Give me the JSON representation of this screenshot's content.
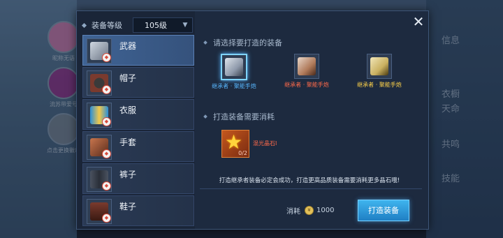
{
  "background": {
    "side_items": [
      {
        "label": "昵称无语",
        "color": "#e07ab0"
      },
      {
        "label": "流苏带爱号",
        "color": "#9c2b8c"
      },
      {
        "label": "点击更换徽章",
        "color": "#7f8a98"
      }
    ],
    "right_tabs": [
      "信息",
      "衣橱",
      "天命",
      "共鸣",
      "技能"
    ]
  },
  "modal": {
    "level": {
      "label": "装备等级",
      "value": "105级"
    },
    "categories": [
      {
        "label": "武器",
        "color": "#9aa6b6"
      },
      {
        "label": "帽子",
        "color": "#7a3a2e"
      },
      {
        "label": "衣服",
        "color": "#2a8fd8"
      },
      {
        "label": "手套",
        "color": "#a85a3a"
      },
      {
        "label": "裤子",
        "color": "#4a5260"
      },
      {
        "label": "鞋子",
        "color": "#7a3a2e"
      }
    ],
    "select_title": "请选择要打造的装备",
    "equipments": [
      {
        "name": "继承者 · 聚能手炮",
        "name_color": "#58b7ff",
        "art_color": "#8f9aab"
      },
      {
        "name": "继承者 · 聚能手炮",
        "name_color": "#ff6a4a",
        "art_color": "#b07a5a"
      },
      {
        "name": "继承者 · 聚能手炮",
        "name_color": "#ffd34a",
        "art_color": "#c9b060"
      }
    ],
    "materials_title": "打造装备需要消耗",
    "material": {
      "name": "混光晶石I",
      "count": "0/2"
    },
    "notice": "打造继承者装备必定会成功，打造更高品质装备需要消耗更多晶石哦!",
    "cost_label": "消耗",
    "cost_value": "1000",
    "forge_button": "打造装备",
    "close_symbol": "✕",
    "caret_symbol": "▼"
  }
}
